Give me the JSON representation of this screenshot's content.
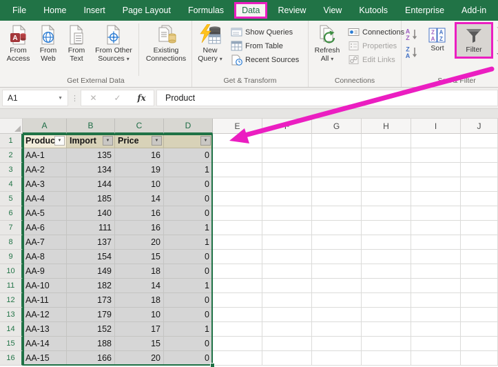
{
  "colors": {
    "excel_green": "#217346",
    "highlight_magenta": "#EB1EC1",
    "selection_gray": "#D6D6D6",
    "table_header_tan": "#D8D2B8",
    "active_cell_cream": "#F2ECDA"
  },
  "tab_bar": {
    "highlighted_tab": "Data",
    "tabs": [
      {
        "label": "File",
        "selected": false
      },
      {
        "label": "Home",
        "selected": false
      },
      {
        "label": "Insert",
        "selected": false
      },
      {
        "label": "Page Layout",
        "selected": false
      },
      {
        "label": "Formulas",
        "selected": false
      },
      {
        "label": "Data",
        "selected": true
      },
      {
        "label": "Review",
        "selected": false
      },
      {
        "label": "View",
        "selected": false
      },
      {
        "label": "Kutools",
        "selected": false
      },
      {
        "label": "Enterprise",
        "selected": false
      },
      {
        "label": "Add-in",
        "selected": false
      }
    ]
  },
  "ribbon": {
    "groups": [
      {
        "label": "Get External Data",
        "buttons": [
          {
            "label": "From Access"
          },
          {
            "label": "From Web"
          },
          {
            "label": "From Text"
          },
          {
            "label": "From Other Sources",
            "dropdown": true
          },
          {
            "label": "Existing Connections"
          }
        ]
      },
      {
        "label": "Get & Transform",
        "big": {
          "label": "New Query",
          "dropdown": true
        },
        "small": [
          {
            "label": "Show Queries",
            "enabled": true
          },
          {
            "label": "From Table",
            "enabled": true
          },
          {
            "label": "Recent Sources",
            "enabled": true
          }
        ]
      },
      {
        "label": "Connections",
        "big": {
          "label": "Refresh All",
          "dropdown": true
        },
        "small": [
          {
            "label": "Connections",
            "enabled": true
          },
          {
            "label": "Properties",
            "enabled": false
          },
          {
            "label": "Edit Links",
            "enabled": false
          }
        ]
      },
      {
        "label": "Sort & Filter",
        "sort": {
          "label": "Sort"
        },
        "filter": {
          "label": "Filter",
          "highlighted": true
        }
      }
    ]
  },
  "formula_bar": {
    "name_box": "A1",
    "formula": "Product"
  },
  "sheet": {
    "columns": [
      "A",
      "B",
      "C",
      "D",
      "E",
      "F",
      "G",
      "H",
      "I",
      "J"
    ],
    "selected_columns": [
      "A",
      "B",
      "C",
      "D"
    ],
    "visible_rows": 16,
    "selected_range": "A1:D16",
    "active_cell": "A1",
    "table": {
      "headers": [
        "Product",
        "Import",
        "Price",
        ""
      ],
      "filter_dropdowns": true,
      "rows": [
        [
          "AA-1",
          135,
          16,
          0
        ],
        [
          "AA-2",
          134,
          19,
          1
        ],
        [
          "AA-3",
          144,
          10,
          0
        ],
        [
          "AA-4",
          185,
          14,
          0
        ],
        [
          "AA-5",
          140,
          16,
          0
        ],
        [
          "AA-6",
          111,
          16,
          1
        ],
        [
          "AA-7",
          137,
          20,
          1
        ],
        [
          "AA-8",
          154,
          15,
          0
        ],
        [
          "AA-9",
          149,
          18,
          0
        ],
        [
          "AA-10",
          182,
          14,
          1
        ],
        [
          "AA-11",
          173,
          18,
          0
        ],
        [
          "AA-12",
          179,
          10,
          0
        ],
        [
          "AA-13",
          152,
          17,
          1
        ],
        [
          "AA-14",
          188,
          15,
          0
        ],
        [
          "AA-15",
          166,
          20,
          0
        ]
      ]
    }
  },
  "icons": {
    "dropdown_caret": "▾",
    "name_box_caret": "▼",
    "formula_divider_dots": "⋮",
    "cancel_x": "✕",
    "enter_check": "✓",
    "insert_function": "fx",
    "filter_header_caret": "▼",
    "sort_arrow": "↓"
  }
}
